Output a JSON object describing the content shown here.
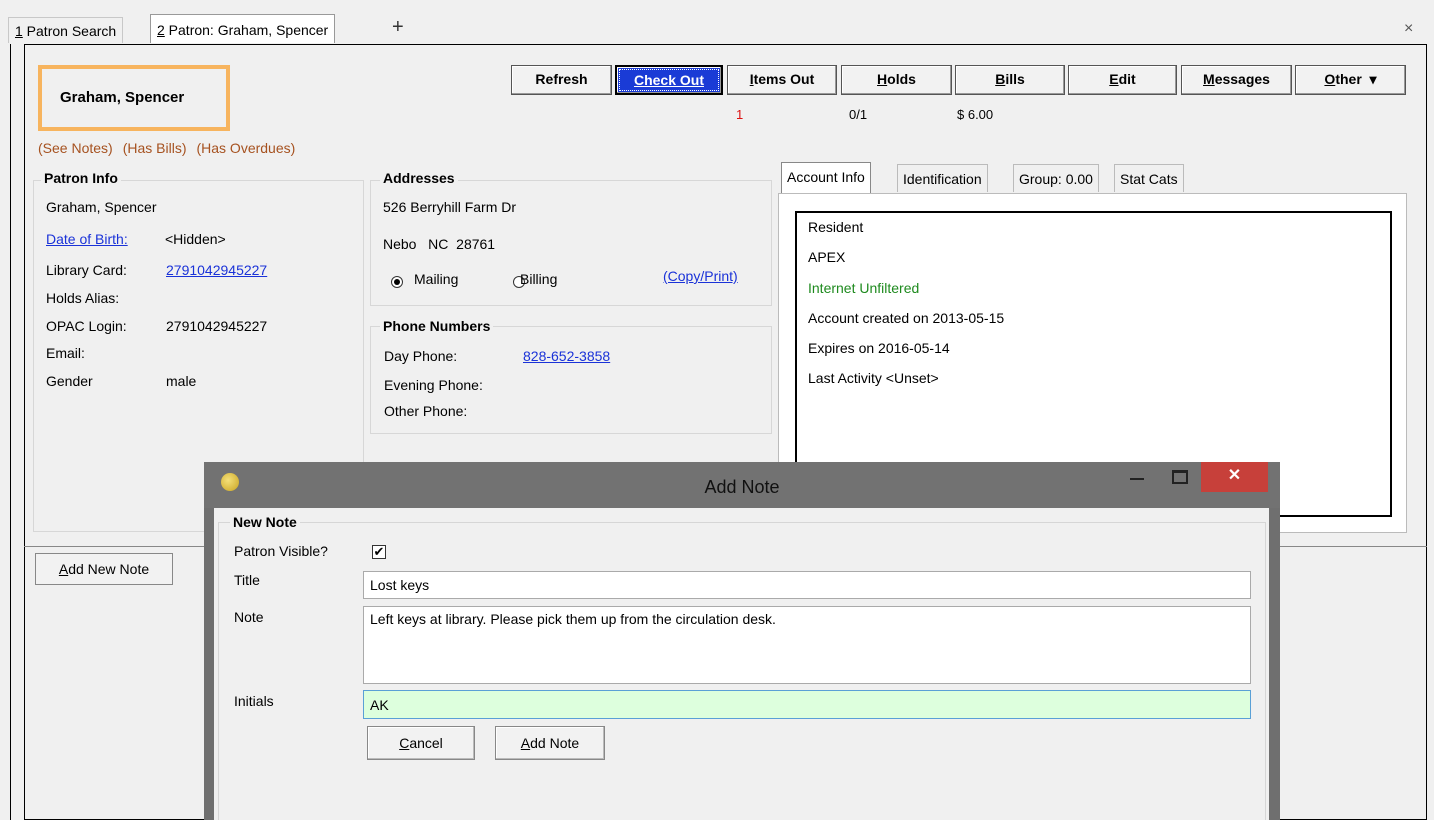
{
  "tabs": [
    {
      "label": "1 Patron Search",
      "hotkey": "1",
      "rest": " Patron Search"
    },
    {
      "label": "2 Patron: Graham, Spencer",
      "hotkey": "2",
      "rest": " Patron: Graham, Spencer"
    }
  ],
  "new_tab_glyph": "+",
  "close_glyph": "×",
  "patron": {
    "name": "Graham, Spencer",
    "alerts": [
      "(See Notes)",
      "(Has Bills)",
      "(Has Overdues)"
    ]
  },
  "toolbar": {
    "refresh": "Refresh",
    "checkout": "Check Out",
    "items_out": "Items Out",
    "items_out_hotkey": "I",
    "items_out_rest": "tems Out",
    "holds_hotkey": "H",
    "holds_rest": "olds",
    "bills_hotkey": "B",
    "bills_rest": "ills",
    "edit_hotkey": "E",
    "edit_rest": "dit",
    "messages_hotkey": "M",
    "messages_rest": "essages",
    "other_hotkey": "O",
    "other_rest": "ther",
    "other_arrow": "▾",
    "items_out_count": "1",
    "holds_count": "0/1",
    "bills_amount": "$ 6.00"
  },
  "patron_info": {
    "title": "Patron Info",
    "name": "Graham, Spencer",
    "dob_label": "Date of Birth:",
    "dob_value": "<Hidden>",
    "card_label": "Library Card:",
    "card_value": "2791042945227",
    "holds_alias_label": "Holds Alias:",
    "opac_label": "OPAC Login:",
    "opac_value": "2791042945227",
    "email_label": "Email:",
    "gender_label": "Gender",
    "gender_value": "male"
  },
  "addresses": {
    "title": "Addresses",
    "street": "526 Berryhill Farm Dr",
    "city": "Nebo",
    "state": "NC",
    "zip": "28761",
    "mailing": "Mailing",
    "billing": "Billing",
    "copy_print": "(Copy/Print)"
  },
  "phones": {
    "title": "Phone Numbers",
    "day_label": "Day Phone:",
    "day_value": "828-652-3858",
    "evening_label": "Evening Phone:",
    "other_label": "Other Phone:"
  },
  "right_tabs": [
    "Account Info",
    "Identification",
    "Group: 0.00",
    "Stat Cats"
  ],
  "account_info": {
    "lines": [
      "Resident",
      "APEX",
      "Internet Unfiltered",
      "Account created on 2013-05-15",
      "Expires on 2016-05-14",
      "Last Activity <Unset>"
    ],
    "highlight_color": "#1e8a1e"
  },
  "add_new_note_hotkey": "A",
  "add_new_note_rest": "dd New Note",
  "dialog": {
    "title": "Add Note",
    "close_glyph": "✕",
    "group_title": "New Note",
    "visible_label": "Patron Visible?",
    "visible_checked": "✔",
    "title_label": "Title",
    "title_value": "Lost keys",
    "note_label": "Note",
    "note_value": "Left keys at library.  Please pick them up from the circulation desk.",
    "initials_label": "Initials",
    "initials_value": "AK",
    "cancel_hotkey": "C",
    "cancel_rest": "ancel",
    "add_hotkey": "A",
    "add_rest": "dd Note"
  }
}
